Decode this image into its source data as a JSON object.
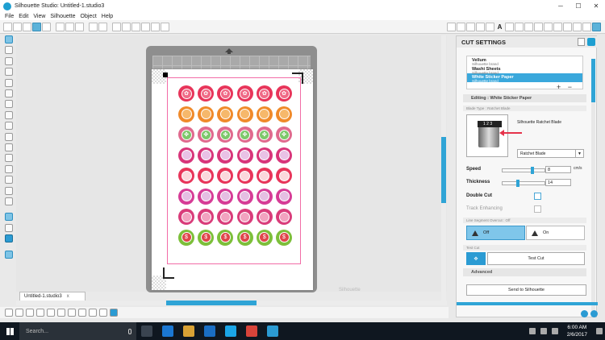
{
  "window": {
    "title": "Silhouette Studio: Untitled-1.studio3",
    "minimize": "─",
    "maximize": "☐",
    "close": "✕"
  },
  "menu": [
    "File",
    "Edit",
    "View",
    "Silhouette",
    "Object",
    "Help"
  ],
  "doc_tab": {
    "label": "Untitled-1.studio3",
    "close": "x"
  },
  "canvas": {
    "watermark": "Silhouette"
  },
  "sheet": {
    "rows": [
      {
        "ring": "#e8355a",
        "inner": "#f06a86",
        "glyph": "✿"
      },
      {
        "ring": "#f08a2a",
        "inner": "#f6b86b",
        "glyph": ""
      },
      {
        "ring": "#e06a8e",
        "inner": "#7cc86a",
        "glyph": "✤"
      },
      {
        "ring": "#d8357a",
        "inner": "#e9c2e6",
        "glyph": ""
      },
      {
        "ring": "#e8355a",
        "inner": "#fbd8dc",
        "glyph": ""
      },
      {
        "ring": "#d63c96",
        "inner": "#e5bfe3",
        "glyph": ""
      },
      {
        "ring": "#d93c7a",
        "inner": "#f2a3c0",
        "glyph": ""
      },
      {
        "ring": "#7cbf3a",
        "inner": "#e0454b",
        "glyph": "$"
      }
    ]
  },
  "panel": {
    "title": "CUT SETTINGS",
    "materials": [
      {
        "name": "Vellum",
        "brand": "Silhouette brand"
      },
      {
        "name": "Washi Sheets",
        "brand": "Silhouette brand"
      },
      {
        "name": "White Sticker Paper",
        "brand": "Silhouette brand",
        "selected": true
      }
    ],
    "plus": "+",
    "minus": "−",
    "editing_label": "Editing : White Sticker Paper",
    "blade_type_label": "Blade Type : Ratchet Blade",
    "blade_name": "Silhouette Ratchet Blade",
    "blade_select": "Ratchet Blade",
    "blade_numbers": "1 2 3",
    "speed_label": "Speed",
    "speed_value": "8",
    "speed_unit": "cm/s",
    "thickness_label": "Thickness",
    "thickness_value": "14",
    "double_cut_label": "Double Cut",
    "track_enhancing_label": "Track Enhancing",
    "line_segment_label": "Line Segment Overcut : Off",
    "off_label": "Off",
    "on_label": "On",
    "test_cut_section": "Test Cut",
    "test_cut_button": "Test Cut",
    "advanced_label": "Advanced",
    "send_button": "Send to Silhouette"
  },
  "taskbar": {
    "search_placeholder": "Search...",
    "time": "6:00 AM",
    "date": "2/6/2017"
  }
}
